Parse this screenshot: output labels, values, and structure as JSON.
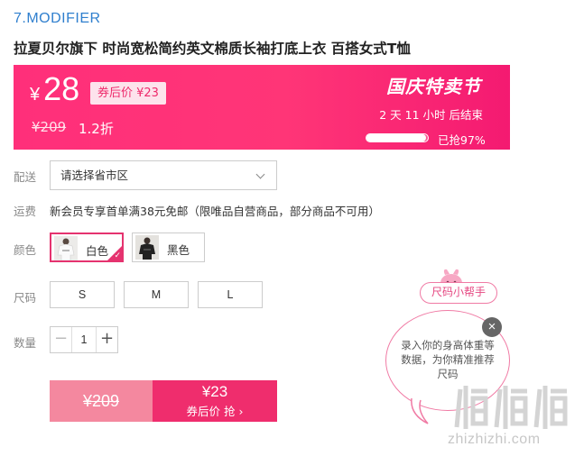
{
  "section_title": "7.MODIFIER",
  "product_title": "拉夏贝尔旗下 时尚宽松简约英文棉质长袖打底上衣 百搭女式T恤",
  "promo": {
    "currency": "¥",
    "price": "28",
    "after_coupon_tag": "券后价 ¥23",
    "original_price": "¥209",
    "discount": "1.2折",
    "festival": "国庆特卖节",
    "countdown": "2 天 11 小时 后结束",
    "sold_label": "已抢97%",
    "sold_fraction": 0.97,
    "colors": {
      "bg_start": "#ff2f7a",
      "bg_end": "#f41a71"
    }
  },
  "delivery": {
    "label": "配送",
    "placeholder": "请选择省市区"
  },
  "shipping": {
    "label": "运费",
    "text": "新会员专享首单满38元免邮（限唯品自营商品，部分商品不可用）"
  },
  "color": {
    "label": "颜色",
    "options": [
      {
        "name": "白色",
        "selected": true
      },
      {
        "name": "黑色",
        "selected": false
      }
    ]
  },
  "size": {
    "label": "尺码",
    "options": [
      "S",
      "M",
      "L"
    ]
  },
  "quantity": {
    "label": "数量",
    "value": "1",
    "minus": "−",
    "plus": "+"
  },
  "buy": {
    "original_price": "¥209",
    "coupon_price": "¥23",
    "coupon_label": "券后价 抢 ›"
  },
  "size_helper": {
    "tag": "尺码小帮手",
    "text": "录入你的身高体重等数据，为你精准推荐尺码",
    "close": "×"
  },
  "watermark": {
    "site": "zhizhizhi.com",
    "logo": "值值值"
  },
  "accent_color": "#ef2d6d"
}
